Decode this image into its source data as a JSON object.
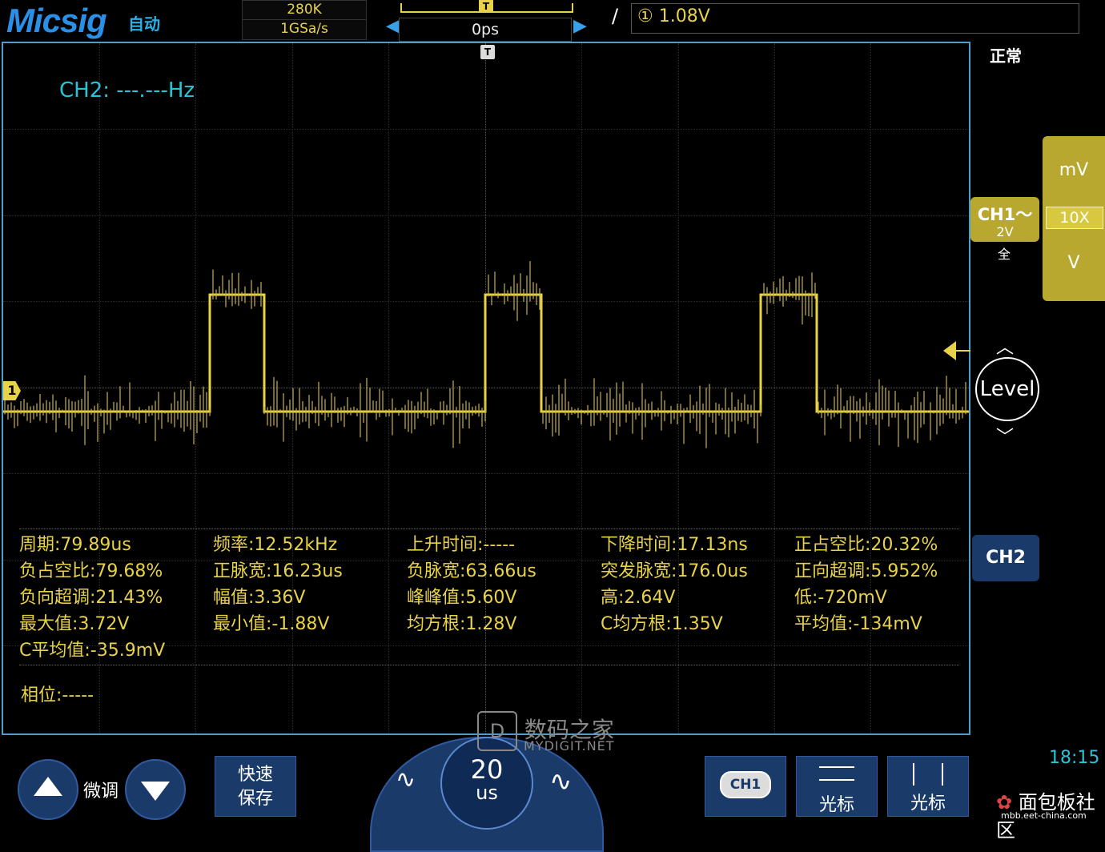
{
  "header": {
    "brand": "Micsig",
    "mode": "自动",
    "memory_depth": "280K",
    "sample_rate": "1GSa/s",
    "time_position": "0ps",
    "trigger_source": "①",
    "trigger_level": "1.08V",
    "trigger_marker": "T"
  },
  "screen": {
    "frequency_readout": "CH2: ---.---Hz",
    "ch1_marker": "1",
    "trigger_marker": "T"
  },
  "measurements": [
    [
      "周期:79.89us",
      "频率:12.52kHz",
      "上升时间:-----",
      "下降时间:17.13ns",
      "正占空比:20.32%"
    ],
    [
      "负占空比:79.68%",
      "正脉宽:16.23us",
      "负脉宽:63.66us",
      "突发脉宽:176.0us",
      "正向超调:5.952%"
    ],
    [
      "负向超调:21.43%",
      "幅值:3.36V",
      "峰峰值:5.60V",
      "高:2.64V",
      "低:-720mV"
    ],
    [
      "最大值:3.72V",
      "最小值:-1.88V",
      "均方根:1.28V",
      "C均方根:1.35V",
      "平均值:-134mV"
    ],
    [
      "C平均值:-35.9mV"
    ]
  ],
  "phase": "相位:-----",
  "right_panel": {
    "acquire_mode": "正常",
    "scale_up_unit": "mV",
    "probe": "10X",
    "scale_down_unit": "V",
    "ch1_name": "CH1～",
    "ch1_scale": "2V",
    "ch1_bandwidth": "全",
    "level_label": "Level",
    "ch2_button": "CH2",
    "clock": "18:15"
  },
  "bottom": {
    "fine_label": "微调",
    "quick_save_line1": "快速",
    "quick_save_line2": "保存",
    "timebase_value": "20",
    "timebase_unit": "us",
    "ch1_button": "CH1",
    "cursor_h_label": "光标",
    "cursor_v_label": "光标"
  },
  "watermarks": {
    "site1_name": "数码之家",
    "site1_url": "MYDIGIT.NET",
    "site2_name": "面包板社区",
    "site2_url": "mbb.eet-china.com"
  },
  "colors": {
    "trace": "#e8d24a",
    "frame": "#4aa0c8",
    "button": "#1a3a6a",
    "freq_text": "#29c4d8"
  }
}
